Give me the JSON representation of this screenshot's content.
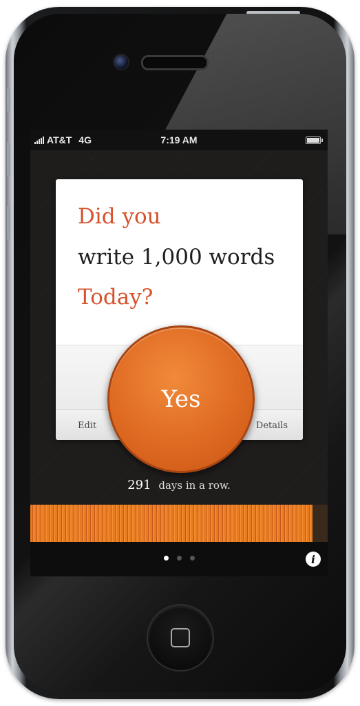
{
  "status_bar": {
    "carrier": "AT&T",
    "network": "4G",
    "time": "7:19 AM"
  },
  "question": {
    "line1": "Did you",
    "line2": "write 1,000 words",
    "line3": "Today?"
  },
  "card_footer": {
    "edit_label": "Edit",
    "details_label": "Details"
  },
  "yes_button": {
    "label": "Yes"
  },
  "streak": {
    "count": "291",
    "label": "days in a row."
  },
  "progress": {
    "fill_fraction": 0.95
  },
  "pager": {
    "pages": 3,
    "active_index": 0
  },
  "info_button": {
    "label": "i"
  },
  "colors": {
    "accent": "#d5532c",
    "button_orange": "#df6a22",
    "card_bg": "#ffffff"
  },
  "icons": [
    "signal-icon",
    "battery-icon",
    "info-icon",
    "home-button-icon"
  ]
}
